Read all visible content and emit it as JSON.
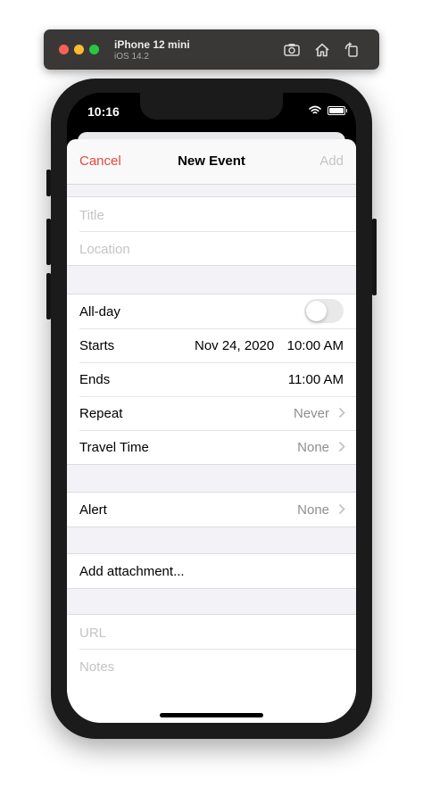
{
  "simulator": {
    "device_name": "iPhone 12 mini",
    "os_version": "iOS 14.2",
    "icons": [
      "screenshot-icon",
      "home-icon",
      "rotate-icon"
    ]
  },
  "status_bar": {
    "time": "10:16"
  },
  "nav": {
    "cancel_label": "Cancel",
    "title": "New Event",
    "add_label": "Add"
  },
  "form": {
    "title_placeholder": "Title",
    "location_placeholder": "Location",
    "all_day_label": "All-day",
    "all_day_on": false,
    "starts_label": "Starts",
    "starts_date": "Nov 24, 2020",
    "starts_time": "10:00 AM",
    "ends_label": "Ends",
    "ends_time": "11:00 AM",
    "repeat_label": "Repeat",
    "repeat_value": "Never",
    "travel_label": "Travel Time",
    "travel_value": "None",
    "alert_label": "Alert",
    "alert_value": "None",
    "attachment_label": "Add attachment...",
    "url_placeholder": "URL",
    "notes_placeholder": "Notes"
  },
  "colors": {
    "accent": "#e5483c",
    "placeholder": "#c4c4c6",
    "secondary_value": "#8e8e93",
    "grouped_background": "#f2f2f7"
  }
}
